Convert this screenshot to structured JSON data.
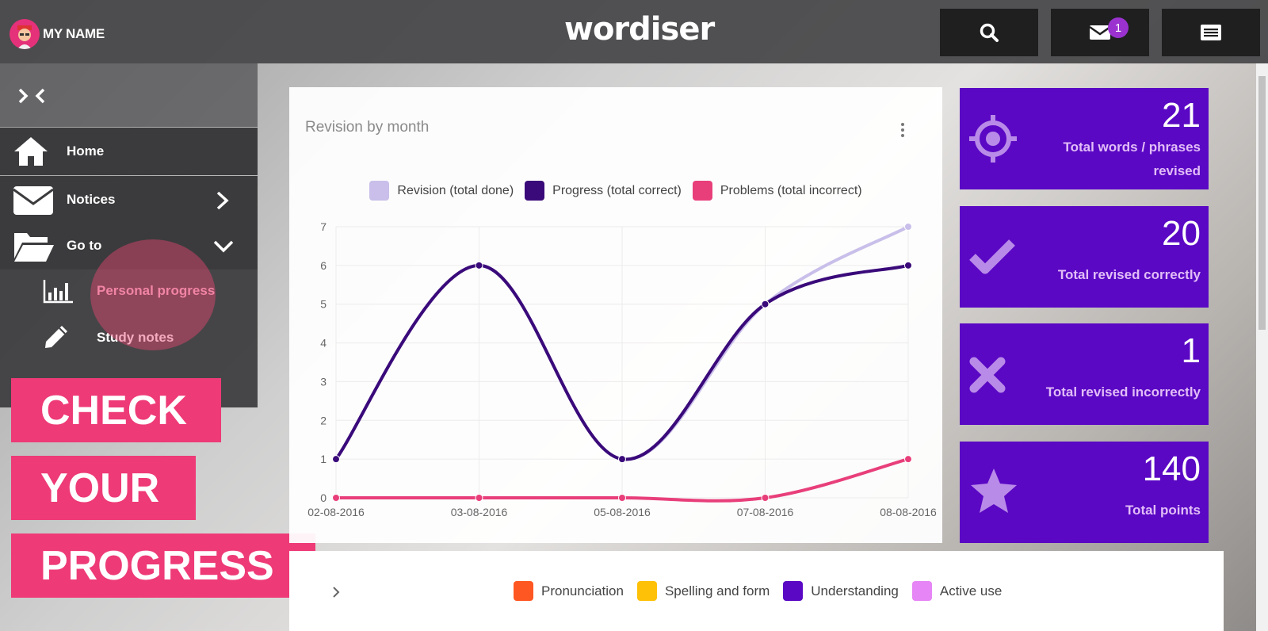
{
  "header": {
    "user_name": "MY NAME",
    "logo_text": "wordiser",
    "notification_count": "1"
  },
  "sidebar": {
    "items": [
      {
        "label": "Home",
        "icon": "home-icon"
      },
      {
        "label": "Notices",
        "icon": "envelope-icon"
      },
      {
        "label": "Go to",
        "icon": "folder-open-icon"
      }
    ],
    "subitems": [
      {
        "label": "Personal progress",
        "icon": "bar-chart-icon"
      },
      {
        "label": "Study notes",
        "icon": "pencil-icon"
      }
    ]
  },
  "promo": {
    "line1": "CHECK",
    "line2": "YOUR",
    "line3": "PROGRESS"
  },
  "chart_panel": {
    "title": "Revision by month"
  },
  "chart_data": {
    "type": "line",
    "title": "Revision by month",
    "categories": [
      "02-08-2016",
      "03-08-2016",
      "05-08-2016",
      "07-08-2016",
      "08-08-2016"
    ],
    "ylim": [
      0,
      7
    ],
    "yticks": [
      0,
      1,
      2,
      3,
      4,
      5,
      6,
      7
    ],
    "grid": true,
    "legend_position": "top",
    "series": [
      {
        "name": "Revision (total done)",
        "color": "#c9bfea",
        "values": [
          1,
          6,
          1,
          5,
          7
        ]
      },
      {
        "name": "Progress (total correct)",
        "color": "#3a0a7a",
        "values": [
          1,
          6,
          1,
          5,
          6
        ]
      },
      {
        "name": "Problems (total incorrect)",
        "color": "#e83f7a",
        "values": [
          0,
          0,
          0,
          0,
          1
        ]
      }
    ]
  },
  "stats": [
    {
      "value": "21",
      "label_line1": "Total words / phrases",
      "label_line2": "revised",
      "icon": "crosshair-icon"
    },
    {
      "value": "20",
      "label_line1": "Total revised correctly",
      "icon": "checkmark-icon"
    },
    {
      "value": "1",
      "label_line1": "Total revised incorrectly",
      "icon": "cross-icon"
    },
    {
      "value": "140",
      "label_line1": "Total points",
      "icon": "star-icon"
    }
  ],
  "skills_legend": [
    {
      "label": "Pronunciation",
      "color": "#ff5722"
    },
    {
      "label": "Spelling and form",
      "color": "#ffc107"
    },
    {
      "label": "Understanding",
      "color": "#5a08c4"
    },
    {
      "label": "Active use",
      "color": "#e685f5"
    }
  ]
}
